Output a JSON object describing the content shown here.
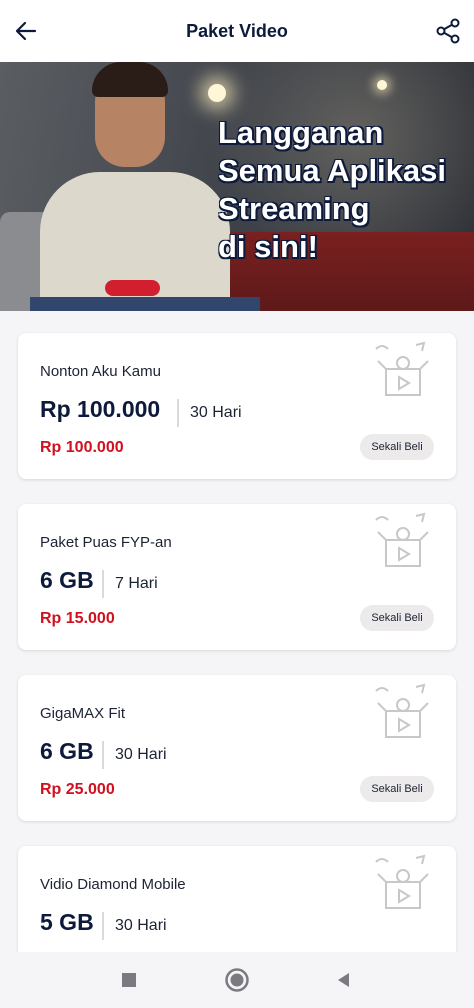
{
  "header": {
    "title": "Paket Video",
    "back_icon": "arrow-left-icon",
    "share_icon": "share-icon"
  },
  "banner": {
    "lines": [
      "Langganan",
      "Semua Aplikasi",
      "Streaming",
      "di sini!"
    ]
  },
  "packages": [
    {
      "name": "Nonton Aku Kamu",
      "quota": "Rp 100.000",
      "duration": "30 Hari",
      "price": "Rp 100.000",
      "buy_label": "Sekali Beli"
    },
    {
      "name": "Paket Puas FYP-an",
      "quota": "6 GB",
      "duration": "7 Hari",
      "price": "Rp 15.000",
      "buy_label": "Sekali Beli"
    },
    {
      "name": "GigaMAX Fit",
      "quota": "6 GB",
      "duration": "30 Hari",
      "price": "Rp 25.000",
      "buy_label": "Sekali Beli"
    },
    {
      "name": "Vidio Diamond Mobile",
      "quota": "5 GB",
      "duration": "30 Hari"
    }
  ],
  "colors": {
    "brand_navy": "#0e1a3b",
    "price_red": "#d0101f",
    "controller_red": "#d21f2f"
  },
  "system_nav": {
    "recent_icon": "square-icon",
    "home_icon": "circle-home-icon",
    "back_icon": "triangle-back-icon"
  }
}
